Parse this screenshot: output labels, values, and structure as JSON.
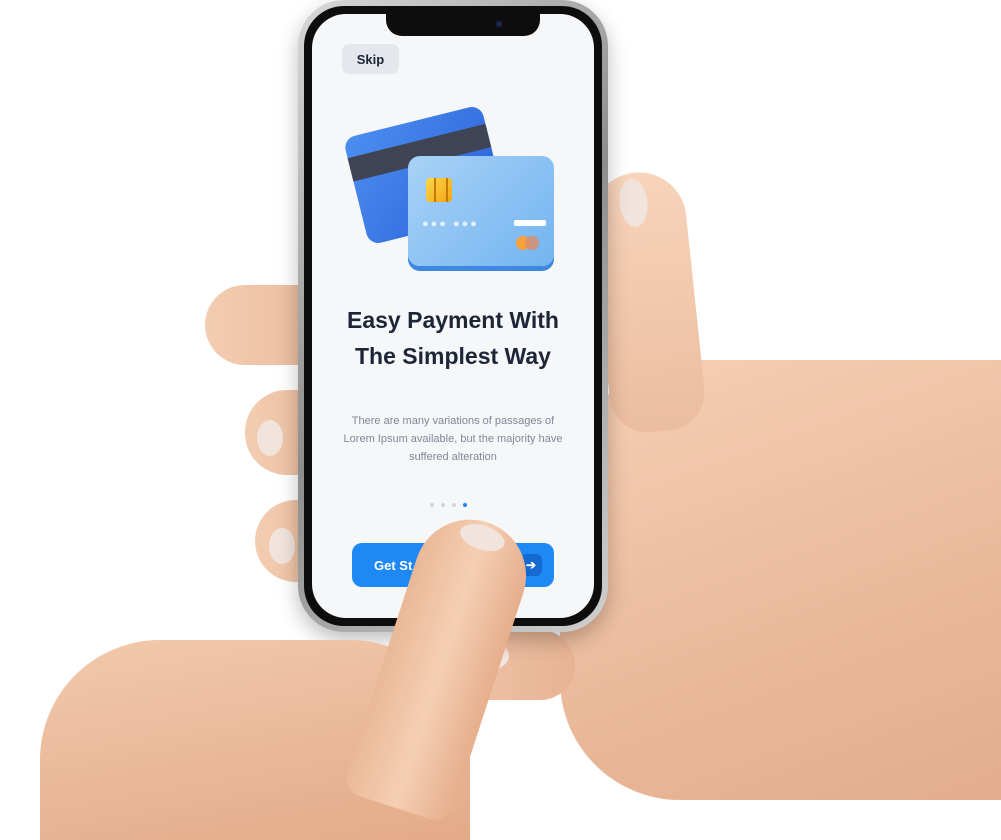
{
  "onboarding": {
    "skip_label": "Skip",
    "headline": "Easy Payment With The Simplest Way",
    "body": "There are many variations of passages of Lorem Ipsum available, but the majority have suffered alteration",
    "pager": {
      "total": 4,
      "active_index": 3
    },
    "cta_label": "Get St",
    "cta_icon": "arrow-right-icon"
  },
  "colors": {
    "accent": "#1e88f5",
    "headline": "#1d2536",
    "body": "#7f8797",
    "screen_bg": "#f6f7f9"
  }
}
